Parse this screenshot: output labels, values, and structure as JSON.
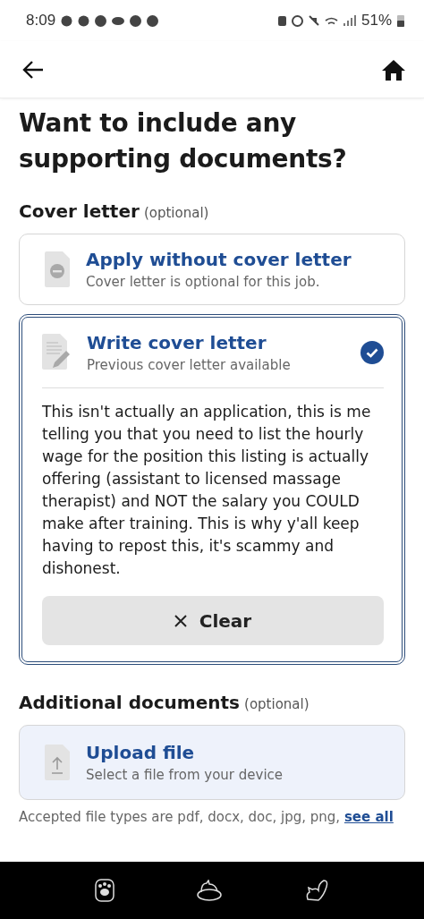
{
  "status_bar": {
    "time": "8:09",
    "battery": "51%"
  },
  "title": "Want to include any supporting documents?",
  "cover_letter": {
    "label": "Cover letter",
    "optional": "(optional)",
    "options": [
      {
        "kind": "skip",
        "title": "Apply without cover letter",
        "subtitle": "Cover letter is optional for this job.",
        "selected": false
      },
      {
        "kind": "write",
        "title": "Write cover letter",
        "subtitle": "Previous cover letter available",
        "selected": true,
        "text": "This isn't actually an application, this is me telling you that you need to list the hourly wage for the position this listing is actually offering (assistant to licensed massage therapist) and NOT the salary you COULD make after training. This is why y'all keep having to repost this, it's scammy and dishonest.",
        "clear_button": "Clear"
      }
    ]
  },
  "additional": {
    "label": "Additional documents",
    "optional": "(optional)",
    "upload": {
      "title": "Upload file",
      "subtitle": "Select a file from your device"
    },
    "accepted": {
      "text": "Accepted file types are pdf, docx, doc, jpg, png,",
      "link": "see all"
    }
  }
}
